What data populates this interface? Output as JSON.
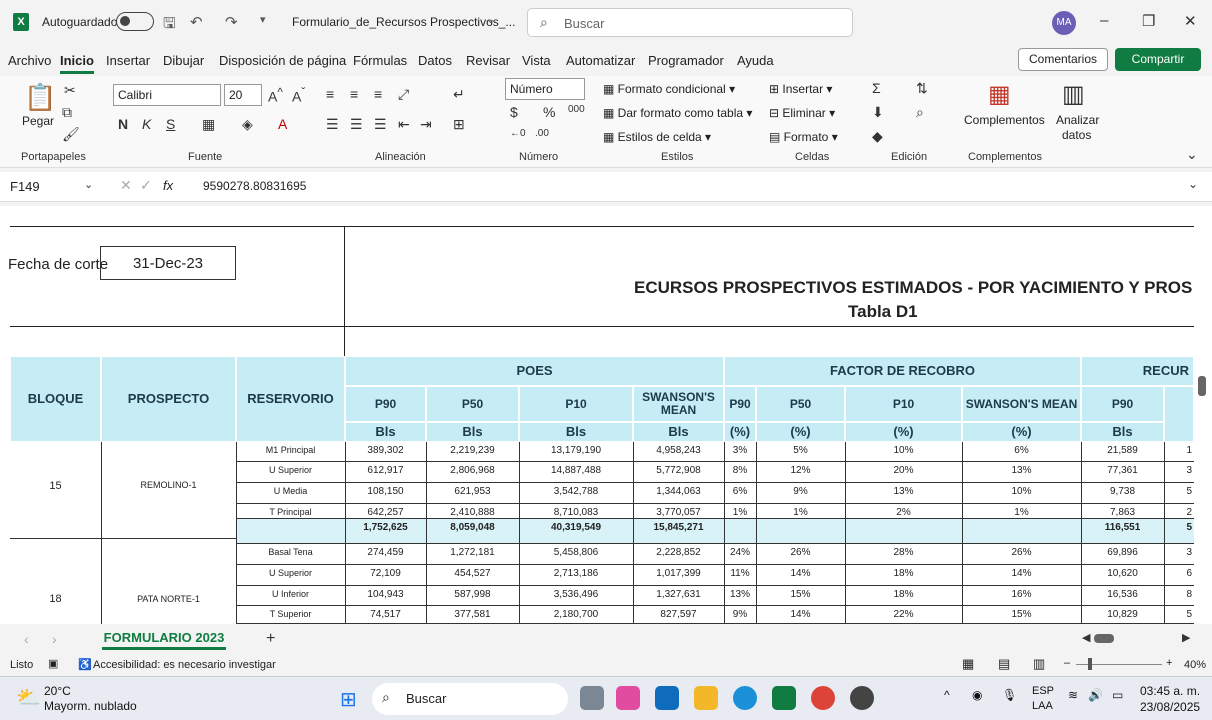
{
  "titlebar": {
    "autosave": "Autoguardado",
    "doc_title": "Formulario_de_Recursos Prospectivos_...",
    "search_placeholder": "Buscar",
    "avatar": "MA"
  },
  "menu": [
    "Archivo",
    "Inicio",
    "Insertar",
    "Dibujar",
    "Disposición de página",
    "Fórmulas",
    "Datos",
    "Revisar",
    "Vista",
    "Automatizar",
    "Programador",
    "Ayuda"
  ],
  "buttons": {
    "comments": "Comentarios",
    "share": "Compartir"
  },
  "ribbon": {
    "paste": "Pegar",
    "font_name": "Calibri",
    "font_size": "20",
    "number_format": "Número",
    "formato_condicional": "Formato condicional",
    "dar_formato": "Dar formato como tabla",
    "estilos_celda": "Estilos de celda",
    "insertar": "Insertar",
    "eliminar": "Eliminar",
    "formato": "Formato",
    "complementos": "Complementos",
    "analizar": "Analizar",
    "datos": "datos",
    "groups": [
      "Portapapeles",
      "Fuente",
      "Alineación",
      "Número",
      "Estilos",
      "Celdas",
      "Edición",
      "Complementos"
    ]
  },
  "formula": {
    "name_box": "F149",
    "value": "9590278.80831695"
  },
  "sheet": {
    "fecha_label": "Fecha de corte",
    "fecha_value": "31-Dec-23",
    "title": "ECURSOS PROSPECTIVOS ESTIMADOS - POR YACIMIENTO Y PROS",
    "subtitle": "Tabla D1",
    "h_bloque": "BLOQUE",
    "h_prospecto": "PROSPECTO",
    "h_reservorio": "RESERVORIO",
    "h_poes": "POES",
    "h_factor": "FACTOR DE RECOBRO",
    "h_recur": "RECUR",
    "sub": [
      "P90",
      "P50",
      "P10",
      "SWANSON'S MEAN",
      "P90",
      "P50",
      "P10",
      "SWANSON'S MEAN",
      "P90"
    ],
    "units": [
      "Bls",
      "Bls",
      "Bls",
      "Bls",
      "(%)",
      "(%)",
      "(%)",
      "(%)",
      "Bls"
    ],
    "bloque1": "15",
    "prospecto1": "REMOLINO-1",
    "bloque2": "18",
    "prospecto2": "PATA NORTE-1",
    "rows": [
      [
        "M1 Principal",
        "389,302",
        "2,219,239",
        "13,179,190",
        "4,958,243",
        "3%",
        "5%",
        "10%",
        "6%",
        "21,589",
        "1"
      ],
      [
        "U Superior",
        "612,917",
        "2,806,968",
        "14,887,488",
        "5,772,908",
        "8%",
        "12%",
        "20%",
        "13%",
        "77,361",
        "3"
      ],
      [
        "U Media",
        "108,150",
        "621,953",
        "3,542,788",
        "1,344,063",
        "6%",
        "9%",
        "13%",
        "10%",
        "9,738",
        "5"
      ],
      [
        "T Principal",
        "642,257",
        "2,410,888",
        "8,710,083",
        "3,770,057",
        "1%",
        "1%",
        "2%",
        "1%",
        "7,863",
        "2"
      ],
      [
        "",
        "1,752,625",
        "8,059,048",
        "40,319,549",
        "15,845,271",
        "",
        "",
        "",
        "",
        "116,551",
        "5"
      ],
      [
        "Basal Tena",
        "274,459",
        "1,272,181",
        "5,458,806",
        "2,228,852",
        "24%",
        "26%",
        "28%",
        "26%",
        "69,896",
        "3"
      ],
      [
        "U Superior",
        "72,109",
        "454,527",
        "2,713,186",
        "1,017,399",
        "11%",
        "14%",
        "18%",
        "14%",
        "10,620",
        "6"
      ],
      [
        "U Inferior",
        "104,943",
        "587,998",
        "3,536,496",
        "1,327,631",
        "13%",
        "15%",
        "18%",
        "16%",
        "16,536",
        "8"
      ],
      [
        "T Superior",
        "74,517",
        "377,581",
        "2,180,700",
        "827,597",
        "9%",
        "14%",
        "22%",
        "15%",
        "10,829",
        "5"
      ]
    ]
  },
  "tabs": {
    "sheet_tab": "FORMULARIO 2023"
  },
  "status": {
    "ready": "Listo",
    "accessibility": "Accesibilidad: es necesario investigar",
    "zoom": "40%"
  },
  "taskbar": {
    "temp": "20°C",
    "weather": "Mayorm. nublado",
    "search": "Buscar",
    "lang1": "ESP",
    "lang2": "LAA",
    "time": "03:45 a. m.",
    "date": "23/08/2025"
  }
}
